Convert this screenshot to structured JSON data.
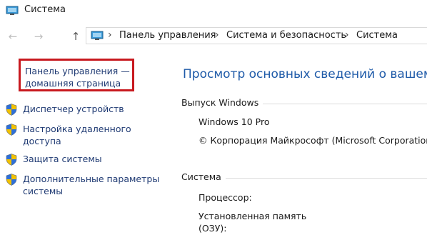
{
  "titlebar": {
    "title": "Система",
    "icon": "computer-icon"
  },
  "nav": {
    "back_icon": "arrow-left-icon",
    "forward_icon": "arrow-right-icon",
    "up_icon": "arrow-up-icon",
    "breadcrumb_sep": "›",
    "breadcrumbs": [
      "Панель управления",
      "Система и безопасность",
      "Система"
    ]
  },
  "sidebar": {
    "home_link_line1": "Панель управления —",
    "home_link_line2": "домашняя страница",
    "items": [
      {
        "label": "Диспетчер устройств",
        "icon": "shield-icon"
      },
      {
        "label": "Настройка удаленного",
        "label2": "доступа",
        "icon": "shield-icon"
      },
      {
        "label": "Защита системы",
        "icon": "shield-icon"
      },
      {
        "label": "Дополнительные параметры",
        "label2": "системы",
        "icon": "shield-icon"
      }
    ]
  },
  "main": {
    "heading": "Просмотр основных сведений о вашем ко",
    "edition_section": {
      "title": "Выпуск Windows",
      "edition": "Windows 10 Pro",
      "copyright": "© Корпорация Майкрософт (Microsoft Corporation"
    },
    "system_section": {
      "title": "Система",
      "processor_label": "Процессор:",
      "memory_label_line1": "Установленная память",
      "memory_label_line2": "(ОЗУ):"
    }
  },
  "colors": {
    "link": "#1f3a73",
    "heading": "#1e5aa8",
    "highlight_border": "#c8191f"
  }
}
